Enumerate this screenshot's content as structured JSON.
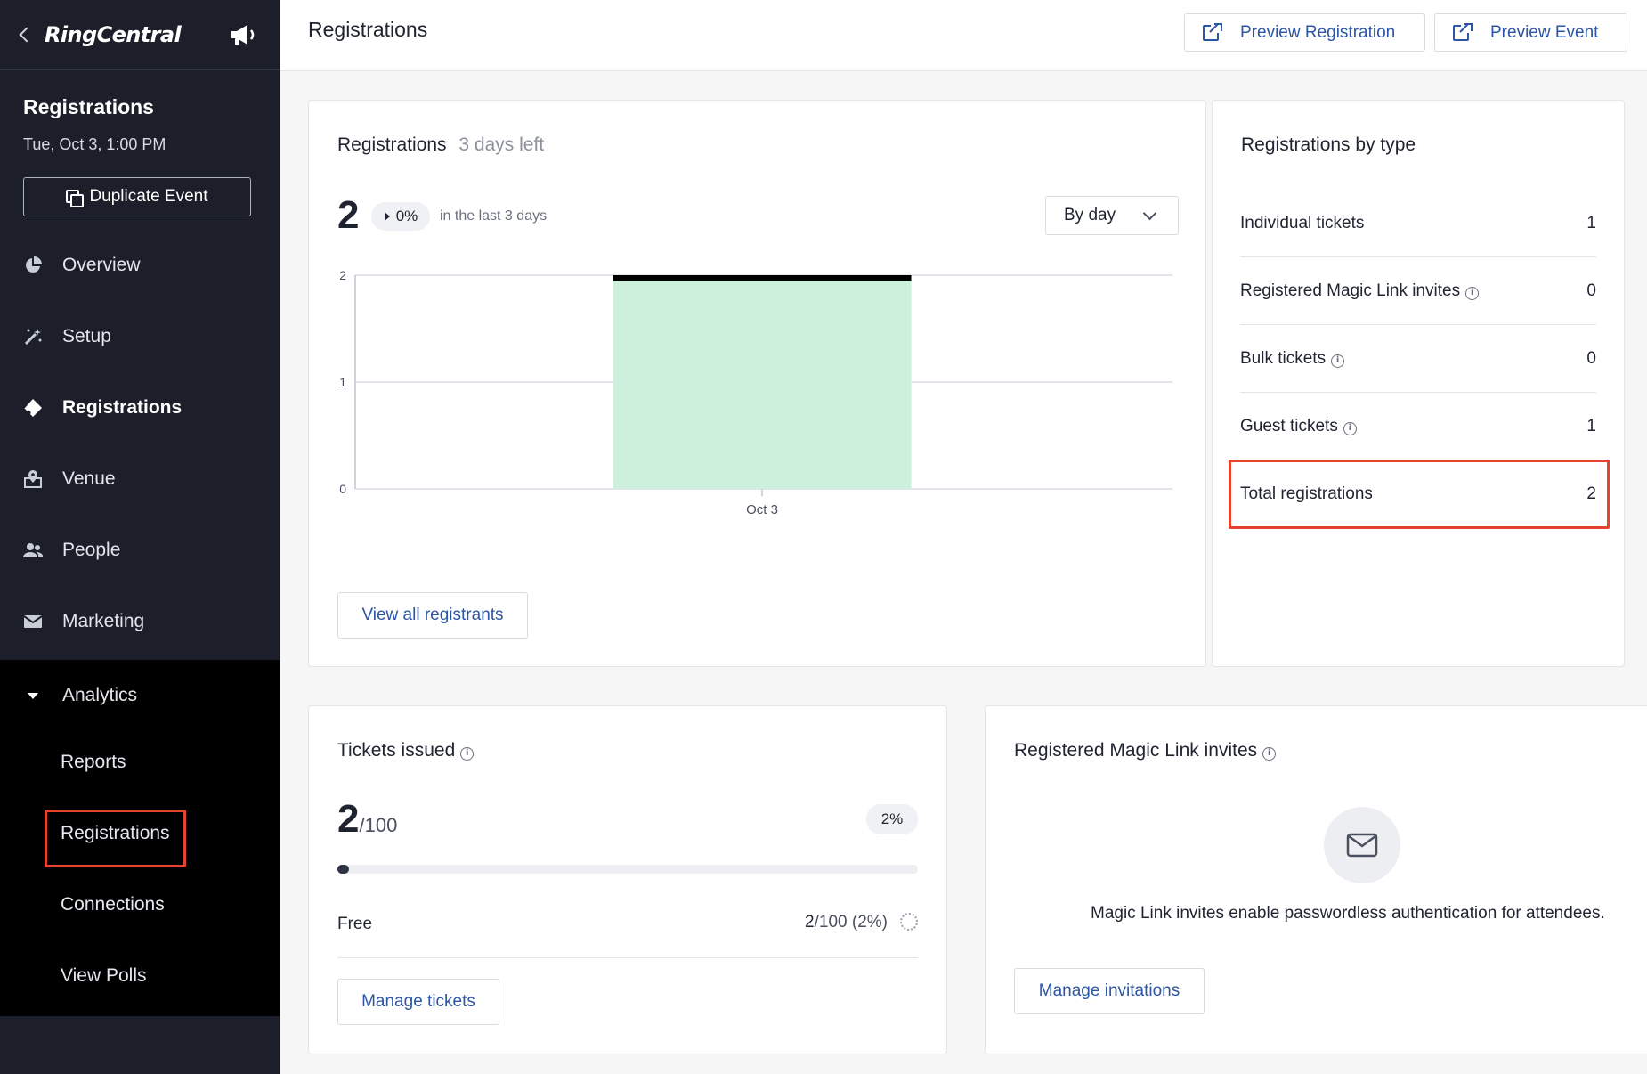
{
  "sidebar": {
    "logo": "RingCentral",
    "event_title": "Registrations",
    "event_date": "Tue, Oct 3, 1:00 PM",
    "duplicate_label": "Duplicate Event",
    "nav": [
      {
        "label": "Overview",
        "icon": "pie-chart-icon"
      },
      {
        "label": "Setup",
        "icon": "magic-wand-icon"
      },
      {
        "label": "Registrations",
        "icon": "ticket-icon"
      },
      {
        "label": "Venue",
        "icon": "venue-icon"
      },
      {
        "label": "People",
        "icon": "people-icon"
      },
      {
        "label": "Marketing",
        "icon": "mail-icon"
      },
      {
        "label": "Analytics",
        "icon": "caret-down-icon"
      }
    ],
    "analytics_sub": [
      "Reports",
      "Registrations",
      "Connections",
      "View Polls"
    ]
  },
  "header": {
    "title": "Registrations",
    "preview_registration": "Preview Registration",
    "preview_event": "Preview Event"
  },
  "registrations_card": {
    "title": "Registrations",
    "days_left": "3 days left",
    "count": "2",
    "change": "0%",
    "period": "in the last 3 days",
    "group_by": "By day",
    "view_all": "View all registrants"
  },
  "chart_data": {
    "type": "bar",
    "categories": [
      "Oct 3"
    ],
    "values": [
      2
    ],
    "ylim": [
      0,
      2
    ],
    "yticks": [
      "0",
      "1",
      "2"
    ],
    "grid": true,
    "bar_color": "#cdf0dc",
    "bar_top_color": "#000000"
  },
  "by_type": {
    "title": "Registrations by type",
    "rows": [
      {
        "label": "Individual tickets",
        "value": "1",
        "info": false
      },
      {
        "label": "Registered Magic Link invites",
        "value": "0",
        "info": true
      },
      {
        "label": "Bulk tickets",
        "value": "0",
        "info": true
      },
      {
        "label": "Guest tickets",
        "value": "1",
        "info": true
      }
    ],
    "total_label": "Total registrations",
    "total_value": "2"
  },
  "tickets": {
    "title": "Tickets issued",
    "issued": "2",
    "capacity": "/100",
    "percent": "2%",
    "progress": 0.02,
    "free_label": "Free",
    "free_count": "2",
    "free_detail": "/100 (2%)",
    "manage": "Manage tickets"
  },
  "magic": {
    "title": "Registered Magic Link invites",
    "description": "Magic Link invites enable passwordless authentication for attendees.",
    "manage": "Manage invitations"
  },
  "colors": {
    "sidebar_bg": "#1c1f2a",
    "accent_link": "#2d55a6",
    "highlight": "#e5432d"
  }
}
